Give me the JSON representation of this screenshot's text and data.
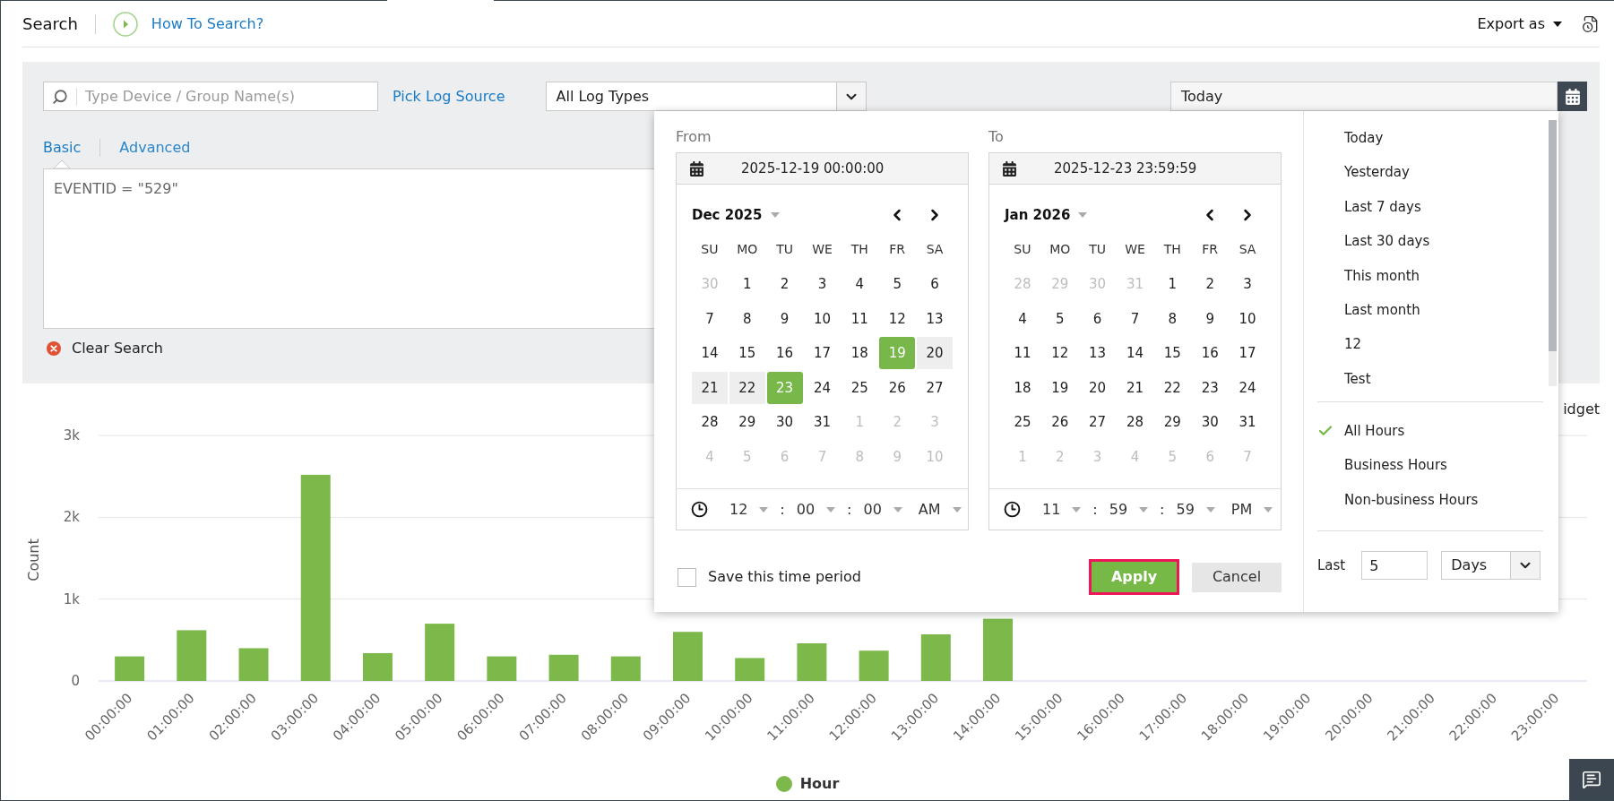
{
  "header": {
    "title": "Search",
    "help_link": "How To Search?",
    "export_label": "Export as"
  },
  "filters": {
    "device_search": {
      "placeholder": "Type Device / Group Name(s)"
    },
    "log_source_link": "Pick Log Source",
    "log_type": {
      "value": "All Log Types"
    },
    "period": {
      "value": "Today"
    }
  },
  "search_tabs": [
    {
      "label": "Basic",
      "selected": true
    },
    {
      "label": "Advanced",
      "selected": false
    }
  ],
  "query": {
    "value": "EVENTID = \"529\""
  },
  "clear_search": "Clear Search",
  "widget_link": "idget",
  "date_picker": {
    "ranges": [
      {
        "label": "From",
        "value": "2025-12-19 00:00:00",
        "month": "Dec 2025",
        "weekdays": [
          "SU",
          "MO",
          "TU",
          "WE",
          "TH",
          "FR",
          "SA"
        ],
        "weeks": [
          [
            {
              "day": "30",
              "outside": true,
              "selected": false,
              "in_range": false
            },
            {
              "day": "1",
              "outside": false,
              "selected": false,
              "in_range": false
            },
            {
              "day": "2",
              "outside": false,
              "selected": false,
              "in_range": false
            },
            {
              "day": "3",
              "outside": false,
              "selected": false,
              "in_range": false
            },
            {
              "day": "4",
              "outside": false,
              "selected": false,
              "in_range": false
            },
            {
              "day": "5",
              "outside": false,
              "selected": false,
              "in_range": false
            },
            {
              "day": "6",
              "outside": false,
              "selected": false,
              "in_range": false
            }
          ],
          [
            {
              "day": "7",
              "outside": false,
              "selected": false,
              "in_range": false
            },
            {
              "day": "8",
              "outside": false,
              "selected": false,
              "in_range": false
            },
            {
              "day": "9",
              "outside": false,
              "selected": false,
              "in_range": false
            },
            {
              "day": "10",
              "outside": false,
              "selected": false,
              "in_range": false
            },
            {
              "day": "11",
              "outside": false,
              "selected": false,
              "in_range": false
            },
            {
              "day": "12",
              "outside": false,
              "selected": false,
              "in_range": false
            },
            {
              "day": "13",
              "outside": false,
              "selected": false,
              "in_range": false
            }
          ],
          [
            {
              "day": "14",
              "outside": false,
              "selected": false,
              "in_range": false
            },
            {
              "day": "15",
              "outside": false,
              "selected": false,
              "in_range": false
            },
            {
              "day": "16",
              "outside": false,
              "selected": false,
              "in_range": false
            },
            {
              "day": "17",
              "outside": false,
              "selected": false,
              "in_range": false
            },
            {
              "day": "18",
              "outside": false,
              "selected": false,
              "in_range": false
            },
            {
              "day": "19",
              "outside": false,
              "selected": true,
              "in_range": false
            },
            {
              "day": "20",
              "outside": false,
              "selected": false,
              "in_range": true
            }
          ],
          [
            {
              "day": "21",
              "outside": false,
              "selected": false,
              "in_range": true
            },
            {
              "day": "22",
              "outside": false,
              "selected": false,
              "in_range": true
            },
            {
              "day": "23",
              "outside": false,
              "selected": true,
              "in_range": false
            },
            {
              "day": "24",
              "outside": false,
              "selected": false,
              "in_range": false
            },
            {
              "day": "25",
              "outside": false,
              "selected": false,
              "in_range": false
            },
            {
              "day": "26",
              "outside": false,
              "selected": false,
              "in_range": false
            },
            {
              "day": "27",
              "outside": false,
              "selected": false,
              "in_range": false
            }
          ],
          [
            {
              "day": "28",
              "outside": false,
              "selected": false,
              "in_range": false
            },
            {
              "day": "29",
              "outside": false,
              "selected": false,
              "in_range": false
            },
            {
              "day": "30",
              "outside": false,
              "selected": false,
              "in_range": false
            },
            {
              "day": "31",
              "outside": false,
              "selected": false,
              "in_range": false
            },
            {
              "day": "1",
              "outside": true,
              "selected": false,
              "in_range": false
            },
            {
              "day": "2",
              "outside": true,
              "selected": false,
              "in_range": false
            },
            {
              "day": "3",
              "outside": true,
              "selected": false,
              "in_range": false
            }
          ],
          [
            {
              "day": "4",
              "outside": true,
              "selected": false,
              "in_range": false
            },
            {
              "day": "5",
              "outside": true,
              "selected": false,
              "in_range": false
            },
            {
              "day": "6",
              "outside": true,
              "selected": false,
              "in_range": false
            },
            {
              "day": "7",
              "outside": true,
              "selected": false,
              "in_range": false
            },
            {
              "day": "8",
              "outside": true,
              "selected": false,
              "in_range": false
            },
            {
              "day": "9",
              "outside": true,
              "selected": false,
              "in_range": false
            },
            {
              "day": "10",
              "outside": true,
              "selected": false,
              "in_range": false
            }
          ]
        ],
        "time": [
          {
            "kind": "select",
            "value": "12"
          },
          {
            "kind": "separator",
            "value": ":"
          },
          {
            "kind": "select",
            "value": "00"
          },
          {
            "kind": "separator",
            "value": ":"
          },
          {
            "kind": "select",
            "value": "00"
          },
          {
            "kind": "select",
            "value": "AM"
          }
        ]
      },
      {
        "label": "To",
        "value": "2025-12-23 23:59:59",
        "month": "Jan 2026",
        "weekdays": [
          "SU",
          "MO",
          "TU",
          "WE",
          "TH",
          "FR",
          "SA"
        ],
        "weeks": [
          [
            {
              "day": "28",
              "outside": true,
              "selected": false,
              "in_range": false
            },
            {
              "day": "29",
              "outside": true,
              "selected": false,
              "in_range": false
            },
            {
              "day": "30",
              "outside": true,
              "selected": false,
              "in_range": false
            },
            {
              "day": "31",
              "outside": true,
              "selected": false,
              "in_range": false
            },
            {
              "day": "1",
              "outside": false,
              "selected": false,
              "in_range": false
            },
            {
              "day": "2",
              "outside": false,
              "selected": false,
              "in_range": false
            },
            {
              "day": "3",
              "outside": false,
              "selected": false,
              "in_range": false
            }
          ],
          [
            {
              "day": "4",
              "outside": false,
              "selected": false,
              "in_range": false
            },
            {
              "day": "5",
              "outside": false,
              "selected": false,
              "in_range": false
            },
            {
              "day": "6",
              "outside": false,
              "selected": false,
              "in_range": false
            },
            {
              "day": "7",
              "outside": false,
              "selected": false,
              "in_range": false
            },
            {
              "day": "8",
              "outside": false,
              "selected": false,
              "in_range": false
            },
            {
              "day": "9",
              "outside": false,
              "selected": false,
              "in_range": false
            },
            {
              "day": "10",
              "outside": false,
              "selected": false,
              "in_range": false
            }
          ],
          [
            {
              "day": "11",
              "outside": false,
              "selected": false,
              "in_range": false
            },
            {
              "day": "12",
              "outside": false,
              "selected": false,
              "in_range": false
            },
            {
              "day": "13",
              "outside": false,
              "selected": false,
              "in_range": false
            },
            {
              "day": "14",
              "outside": false,
              "selected": false,
              "in_range": false
            },
            {
              "day": "15",
              "outside": false,
              "selected": false,
              "in_range": false
            },
            {
              "day": "16",
              "outside": false,
              "selected": false,
              "in_range": false
            },
            {
              "day": "17",
              "outside": false,
              "selected": false,
              "in_range": false
            }
          ],
          [
            {
              "day": "18",
              "outside": false,
              "selected": false,
              "in_range": false
            },
            {
              "day": "19",
              "outside": false,
              "selected": false,
              "in_range": false
            },
            {
              "day": "20",
              "outside": false,
              "selected": false,
              "in_range": false
            },
            {
              "day": "21",
              "outside": false,
              "selected": false,
              "in_range": false
            },
            {
              "day": "22",
              "outside": false,
              "selected": false,
              "in_range": false
            },
            {
              "day": "23",
              "outside": false,
              "selected": false,
              "in_range": false
            },
            {
              "day": "24",
              "outside": false,
              "selected": false,
              "in_range": false
            }
          ],
          [
            {
              "day": "25",
              "outside": false,
              "selected": false,
              "in_range": false
            },
            {
              "day": "26",
              "outside": false,
              "selected": false,
              "in_range": false
            },
            {
              "day": "27",
              "outside": false,
              "selected": false,
              "in_range": false
            },
            {
              "day": "28",
              "outside": false,
              "selected": false,
              "in_range": false
            },
            {
              "day": "29",
              "outside": false,
              "selected": false,
              "in_range": false
            },
            {
              "day": "30",
              "outside": false,
              "selected": false,
              "in_range": false
            },
            {
              "day": "31",
              "outside": false,
              "selected": false,
              "in_range": false
            }
          ],
          [
            {
              "day": "1",
              "outside": true,
              "selected": false,
              "in_range": false
            },
            {
              "day": "2",
              "outside": true,
              "selected": false,
              "in_range": false
            },
            {
              "day": "3",
              "outside": true,
              "selected": false,
              "in_range": false
            },
            {
              "day": "4",
              "outside": true,
              "selected": false,
              "in_range": false
            },
            {
              "day": "5",
              "outside": true,
              "selected": false,
              "in_range": false
            },
            {
              "day": "6",
              "outside": true,
              "selected": false,
              "in_range": false
            },
            {
              "day": "7",
              "outside": true,
              "selected": false,
              "in_range": false
            }
          ]
        ],
        "time": [
          {
            "kind": "select",
            "value": "11"
          },
          {
            "kind": "separator",
            "value": ":"
          },
          {
            "kind": "select",
            "value": "59"
          },
          {
            "kind": "separator",
            "value": ":"
          },
          {
            "kind": "select",
            "value": "59"
          },
          {
            "kind": "select",
            "value": "PM"
          }
        ]
      }
    ],
    "save_period": {
      "label": "Save this time period",
      "checked": false
    },
    "buttons": [
      {
        "label": "Apply",
        "kind": "primary",
        "highlighted": true
      },
      {
        "label": "Cancel",
        "kind": "secondary",
        "highlighted": false
      }
    ],
    "presets": [
      "Today",
      "Yesterday",
      "Last 7 days",
      "Last 30 days",
      "This month",
      "Last month",
      "12",
      "Test"
    ],
    "hour_filters": [
      {
        "label": "All Hours",
        "selected": true
      },
      {
        "label": "Business Hours",
        "selected": false
      },
      {
        "label": "Non-business Hours",
        "selected": false
      }
    ],
    "last": {
      "label": "Last",
      "value": "5",
      "unit": "Days"
    }
  },
  "chart": {
    "chart_data": {
      "type": "bar",
      "ylabel": "Count",
      "categories": [
        "00:00:00",
        "01:00:00",
        "02:00:00",
        "03:00:00",
        "04:00:00",
        "05:00:00",
        "06:00:00",
        "07:00:00",
        "08:00:00",
        "09:00:00",
        "10:00:00",
        "11:00:00",
        "12:00:00",
        "13:00:00",
        "14:00:00",
        "15:00:00",
        "16:00:00",
        "17:00:00",
        "18:00:00",
        "19:00:00",
        "20:00:00",
        "21:00:00",
        "22:00:00",
        "23:00:00"
      ],
      "series": [
        {
          "name": "Hour",
          "color": "#7cb94a",
          "values": [
            300,
            620,
            400,
            2520,
            340,
            700,
            300,
            320,
            300,
            600,
            280,
            460,
            370,
            570,
            760,
            null,
            null,
            null,
            null,
            null,
            null,
            null,
            null,
            null
          ]
        }
      ],
      "ylim": [
        0,
        3000
      ],
      "yticks": [
        {
          "value": 0,
          "label": "0"
        },
        {
          "value": 1000,
          "label": "1k"
        },
        {
          "value": 2000,
          "label": "2k"
        },
        {
          "value": 3000,
          "label": "3k"
        }
      ]
    }
  }
}
